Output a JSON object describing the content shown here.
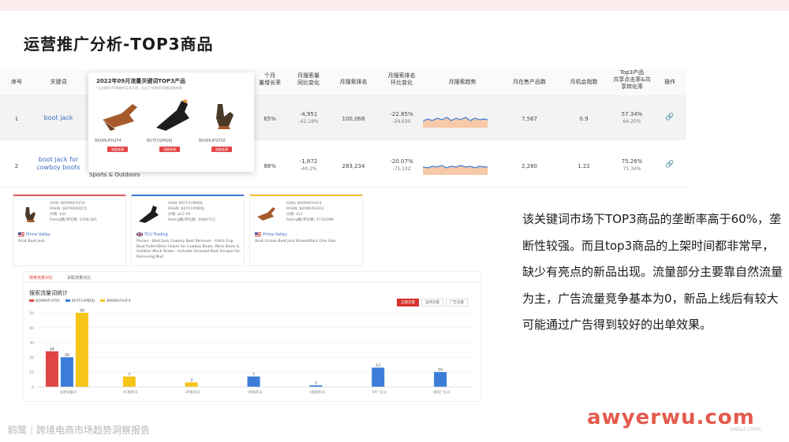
{
  "slide": {
    "title": "运营推广分析-TOP3商品",
    "note": "该关键词市场下TOP3商品的垄断率高于60%，垄断性较强。而且top3商品的上架时间都非常早，缺少有亮点的新品出现。流量部分主要靠自然流量为主，广告流量竞争基本为0，新品上线后有较大可能通过广告得到较好的出单效果。",
    "footer": "鸥鹭｜跨境电商市场趋势洞察报告",
    "watermark": "awyerwu.com",
    "watermark_small": "oalur.com"
  },
  "table": {
    "headers": [
      "序号",
      "关键词",
      "",
      "",
      "个月\n量增长率",
      "月搜索量\n同比变化",
      "月搜索排名",
      "月搜索排名\n环比变化",
      "月搜索趋势",
      "月在售产品数",
      "月机会指数",
      "Top3产品\n共享点击率&共\n享转化率",
      "操作"
    ],
    "rows": [
      {
        "idx": "1",
        "keyword": "boot jack",
        "growth": "65%",
        "yoy": "-4,951",
        "yoy_pct": "-42.18%",
        "rank": "100,068",
        "rank_chg": "-22.85%",
        "rank_chg2": "-29,630",
        "products": "7,567",
        "opportunity": "0.9",
        "share_click": "57.34%",
        "share_conv": "64.25%"
      },
      {
        "idx": "2",
        "keyword": "boot jack for cowboy boots",
        "growth": "88%",
        "yoy": "-1,872",
        "yoy_pct": "-40.2%",
        "rank": "283,234",
        "rank_chg": "-20.07%",
        "rank_chg2": "-71,132",
        "products": "2,280",
        "opportunity": "1.22",
        "share_click": "75.26%",
        "share_conv": "71.34%"
      }
    ],
    "category": "Sports & Outdoors"
  },
  "popup": {
    "title": "2022年09月流量关键词TOP3产品",
    "subtitle": "*点击图片/ASIN跳转至亚马逊，点击下方按钮可查看流量来源",
    "products": [
      {
        "asin": "B00MUFH2F4",
        "button": "流量来源"
      },
      {
        "asin": "B07F1VMDRJ",
        "button": "流量来源"
      },
      {
        "asin": "B00MUFGY50",
        "button": "流量来源"
      }
    ]
  },
  "cards": [
    {
      "asin": "ASIN: B00MUFGY50",
      "parent": "PASIN: B07RDX9ZC5",
      "price": "价格: $31",
      "rating": "Rating数/评论数: 2166/381",
      "brand": "Prime Valley",
      "desc": "Ariat Boot Jack",
      "color": "#e05a5a"
    },
    {
      "asin": "ASIN: B07F1VMDRJ",
      "parent": "PASIN: B07F1VMDRJ",
      "price": "价格: $12.99",
      "rating": "Rating数/评论数: 3480/712",
      "brand": "TCU Trading",
      "desc": "Pluries - Boot Jack Cowboy Boot Remover - Extra Grip Boot Puller/Shoe Helper for Cowboy Boots, Work Boots & Outdoor Muck Shoes - Includes Grooved Boot Scraper for Removing Mud",
      "color": "#3b7dd8"
    },
    {
      "asin": "ASIN: B00MUFH2F4",
      "parent": "PASIN: B00MUFH2F4",
      "price": "价格: $17",
      "rating": "Rating数/评论数: 4716/998",
      "brand": "Prime Valley",
      "desc": "Ariat Unisex Boot Jack Brown/Black One Size",
      "color": "#f2c230"
    }
  ],
  "traffic": {
    "tabs": [
      "搜索流量对比",
      "关联流量对比"
    ],
    "title": "搜索流量词统计",
    "buttons": [
      "全部流量",
      "自然流量",
      "广告流量"
    ]
  },
  "chart_data": {
    "type": "bar",
    "title": "搜索流量词统计",
    "categories": [
      "自然流量词",
      "AC推荐词",
      "ER推荐词",
      "HR推荐词",
      "4星推荐词",
      "SP广告词",
      "视频广告词"
    ],
    "series": [
      {
        "name": "B00MUFGY50",
        "color": "#e04545",
        "values": [
          24,
          0,
          0,
          0,
          0,
          0,
          0
        ]
      },
      {
        "name": "B07F1VMDRJ",
        "color": "#3b7dd8",
        "values": [
          20,
          0,
          0,
          7,
          1,
          13,
          10
        ]
      },
      {
        "name": "B00MUFH2F4",
        "color": "#f5c518",
        "values": [
          50,
          7,
          3,
          0,
          0,
          0,
          0
        ]
      }
    ],
    "ylim": [
      0,
      50
    ],
    "yticks": [
      0,
      10,
      20,
      30,
      40,
      50
    ],
    "legend": "top-left"
  }
}
